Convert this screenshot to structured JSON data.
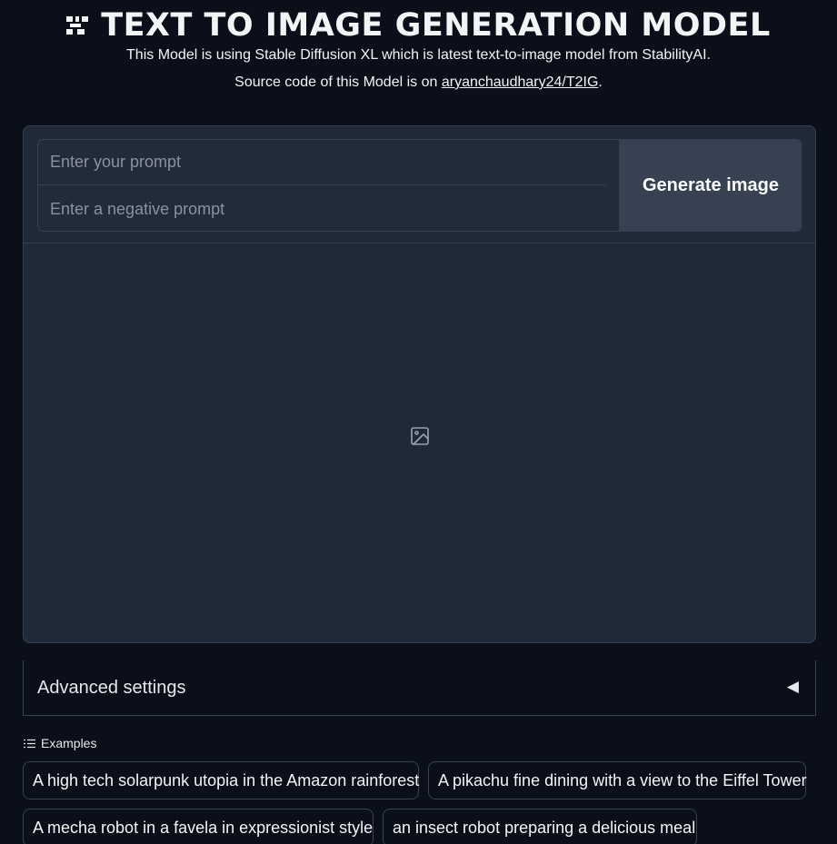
{
  "header": {
    "logo_icon": "qr-pixel-logo-icon",
    "title": "TEXT TO IMAGE GENERATION MODEL",
    "subtitle": "This Model is using Stable Diffusion XL which is latest text-to-image model from StabilityAI.",
    "source_prefix": "Source code of this Model is on ",
    "source_link_text": "aryanchaudhary24/T2IG",
    "source_suffix": "."
  },
  "form": {
    "prompt_placeholder": "Enter your prompt",
    "prompt_value": "",
    "negative_prompt_placeholder": "Enter a negative prompt",
    "negative_prompt_value": "",
    "generate_label": "Generate image"
  },
  "output": {
    "placeholder_icon": "image-icon"
  },
  "advanced": {
    "label": "Advanced settings",
    "arrow": "◀",
    "expanded": false
  },
  "examples": {
    "header_icon": "list-icon",
    "label": "Examples",
    "items": [
      "A high tech solarpunk utopia in the Amazon rainforest",
      "A pikachu fine dining with a view to the Eiffel Tower",
      "A mecha robot in a favela in expressionist style",
      "an insect robot preparing a delicious meal"
    ]
  },
  "colors": {
    "background": "#0b0f19",
    "panel": "#1f2937",
    "border": "#374151",
    "button": "#374151",
    "text": "#e5e7eb"
  }
}
